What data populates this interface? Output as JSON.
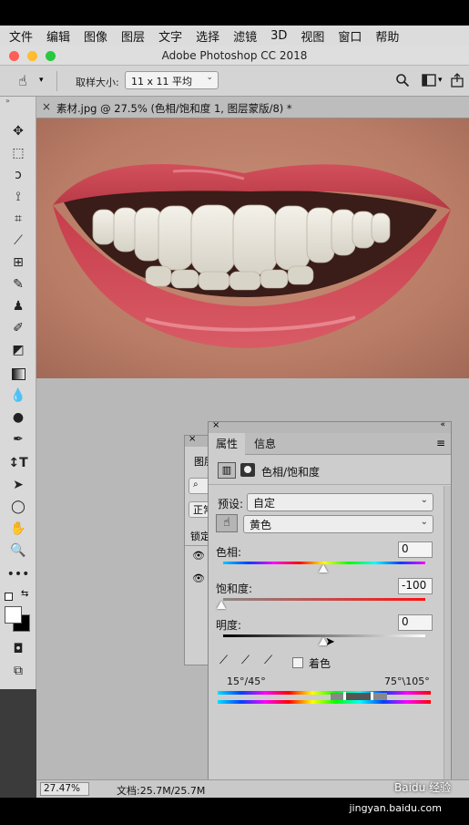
{
  "menu": [
    "文件",
    "编辑",
    "图像",
    "图层",
    "文字",
    "选择",
    "滤镜",
    "3D",
    "视图",
    "窗口",
    "帮助"
  ],
  "app_title": "Adobe Photoshop CC 2018",
  "options": {
    "sample_label": "取样大小:",
    "sample_value": "11 x 11 平均"
  },
  "document_tab": "素材.jpg @ 27.5% (色相/饱和度 1, 图层蒙版/8) *",
  "layers_panel": {
    "tab": "图层",
    "mode_value": "正常",
    "lock_label": "锁定"
  },
  "properties": {
    "tabs": [
      "属性",
      "信息"
    ],
    "title": "色相/饱和度",
    "preset_label": "预设:",
    "preset_value": "自定",
    "channel_value": "黄色",
    "hue_label": "色相:",
    "hue_value": "0",
    "saturation_label": "饱和度:",
    "saturation_value": "-100",
    "lightness_label": "明度:",
    "lightness_value": "0",
    "colorize_label": "着色",
    "range_left": "15°/45°",
    "range_right": "75°\\105°"
  },
  "status": {
    "zoom": "27.47%",
    "doc_size": "文档:25.7M/25.7M"
  },
  "watermark": "Baidu 经验",
  "watermark_url": "jingyan.baidu.com",
  "colors": {
    "lip": "#c7434f",
    "skin": "#b9806a"
  }
}
